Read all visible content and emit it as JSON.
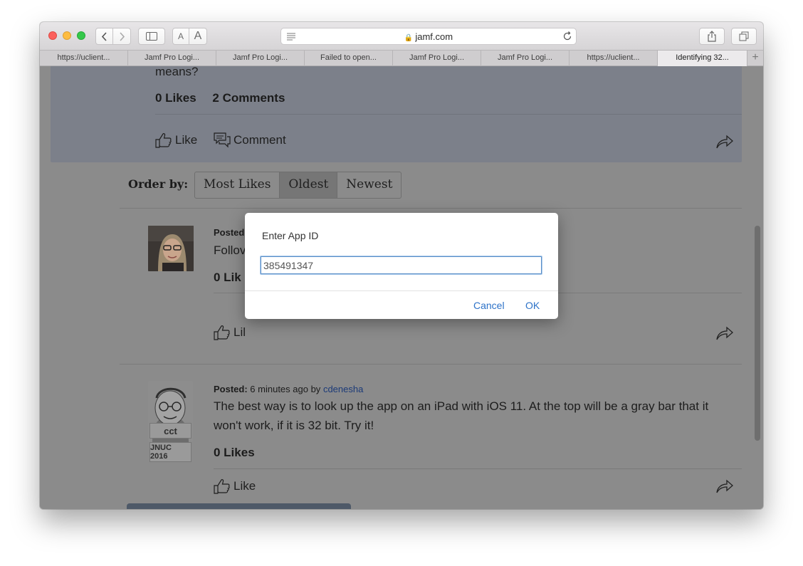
{
  "browser": {
    "url": "jamf.com",
    "font_small_label": "A",
    "font_large_label": "A",
    "tabs": [
      {
        "label": "https://uclient..."
      },
      {
        "label": "Jamf Pro Logi..."
      },
      {
        "label": "Jamf Pro Logi..."
      },
      {
        "label": "Failed to open..."
      },
      {
        "label": "Jamf Pro Logi..."
      },
      {
        "label": "Jamf Pro Logi..."
      },
      {
        "label": "https://uclient..."
      },
      {
        "label": "Identifying 32..."
      }
    ],
    "new_tab_label": "+"
  },
  "post": {
    "text_tail": "means?",
    "likes": "0 Likes",
    "comments": "2 Comments",
    "like_label": "Like",
    "comment_label": "Comment"
  },
  "order": {
    "label": "Order by:",
    "options": [
      "Most Likes",
      "Oldest",
      "Newest"
    ],
    "selected": "Oldest"
  },
  "replies": [
    {
      "posted_label": "Posted",
      "body_fragment": "Follov",
      "likes_fragment": "0 Lik",
      "like_fragment": "Lil"
    },
    {
      "posted_label": "Posted:",
      "time": "6 minutes ago by",
      "user": "cdenesha",
      "body_line1": "The best way is to look up the app on an iPad with iOS 11. At the top will be a gray bar that it",
      "body_line2": "won't work, if it is 32 bit. Try it!",
      "likes": "0 Likes",
      "like_label": "Like",
      "badges": [
        "cct",
        "JNUC 2016"
      ]
    }
  ],
  "dialog": {
    "title": "Enter App ID",
    "input_value": "385491347",
    "cancel_label": "Cancel",
    "ok_label": "OK"
  }
}
